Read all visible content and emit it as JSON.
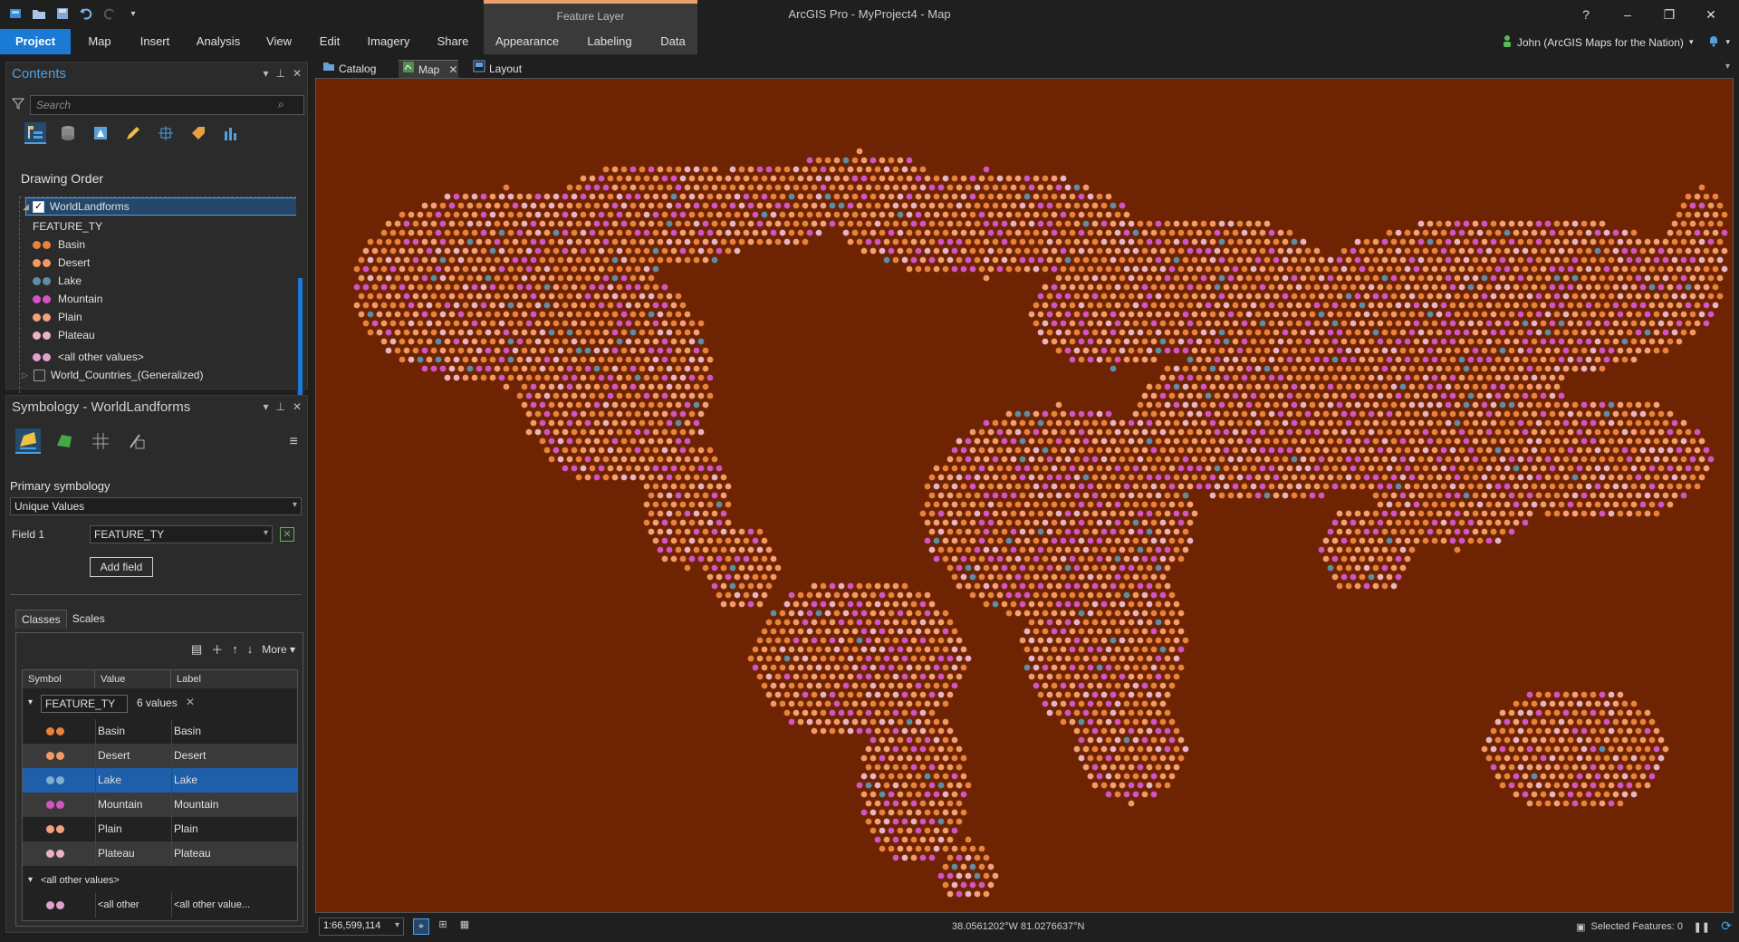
{
  "app": {
    "title": "ArcGIS Pro - MyProject4 - Map",
    "context_header": "Feature Layer",
    "user": "John (ArcGIS Maps for the Nation)",
    "window_buttons": [
      "?",
      "–",
      "❐",
      "✕"
    ]
  },
  "ribbon": {
    "tabs": [
      "Project",
      "Map",
      "Insert",
      "Analysis",
      "View",
      "Edit",
      "Imagery",
      "Share",
      "Appearance",
      "Labeling",
      "Data"
    ]
  },
  "contents": {
    "title": "Contents",
    "search_placeholder": "Search",
    "drawing_order_label": "Drawing Order",
    "layer_name": "WorldLandforms",
    "field_heading": "FEATURE_TY",
    "classes": [
      {
        "label": "Basin",
        "color": "#e8823c"
      },
      {
        "label": "Desert",
        "color": "#f29a62"
      },
      {
        "label": "Lake",
        "color": "#5d8ea8"
      },
      {
        "label": "Mountain",
        "color": "#d454c6"
      },
      {
        "label": "Plain",
        "color": "#f4a07a"
      },
      {
        "label": "Plateau",
        "color": "#e8b4c4"
      }
    ],
    "other_values": "<all other values>",
    "second_layer": "World_Countries_(Generalized)"
  },
  "symbology": {
    "title": "Symbology - WorldLandforms",
    "primary_label": "Primary symbology",
    "primary_value": "Unique Values",
    "field1_label": "Field 1",
    "field1_value": "FEATURE_TY",
    "add_field": "Add field",
    "tabs": [
      "Classes",
      "Scales"
    ],
    "more": "More",
    "columns": [
      "Symbol",
      "Value",
      "Label"
    ],
    "group_field": "FEATURE_TY",
    "group_count": "6 values",
    "rows": [
      {
        "value": "Basin",
        "label": "Basin"
      },
      {
        "value": "Desert",
        "label": "Desert"
      },
      {
        "value": "Lake",
        "label": "Lake"
      },
      {
        "value": "Mountain",
        "label": "Mountain"
      },
      {
        "value": "Plain",
        "label": "Plain"
      },
      {
        "value": "Plateau",
        "label": "Plateau"
      }
    ],
    "other_group": "<all other values>",
    "other_value": "<all other value...",
    "other_label": "<all other value..."
  },
  "views": {
    "tabs": [
      "Catalog",
      "Map",
      "Layout"
    ],
    "active": "Map"
  },
  "map": {
    "background": "#6e2402"
  },
  "status": {
    "scale": "1:66,599,114",
    "coords": "38.0561202°W 81.0276637°N",
    "selected": "Selected Features: 0"
  }
}
